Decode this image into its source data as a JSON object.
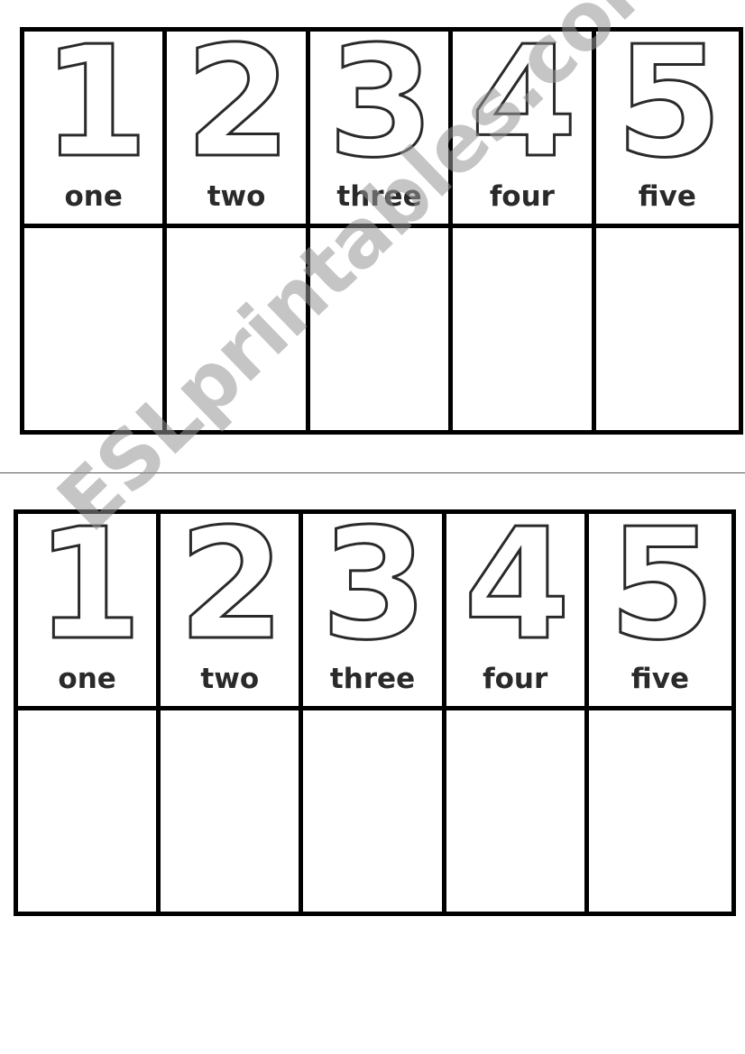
{
  "worksheets": [
    {
      "numbers": [
        {
          "digit": "1",
          "word": "one"
        },
        {
          "digit": "2",
          "word": "two"
        },
        {
          "digit": "3",
          "word": "three"
        },
        {
          "digit": "4",
          "word": "four"
        },
        {
          "digit": "5",
          "word": "five"
        }
      ]
    },
    {
      "numbers": [
        {
          "digit": "1",
          "word": "one"
        },
        {
          "digit": "2",
          "word": "two"
        },
        {
          "digit": "3",
          "word": "three"
        },
        {
          "digit": "4",
          "word": "four"
        },
        {
          "digit": "5",
          "word": "five"
        }
      ]
    }
  ],
  "watermark": "ESLprintables.com"
}
